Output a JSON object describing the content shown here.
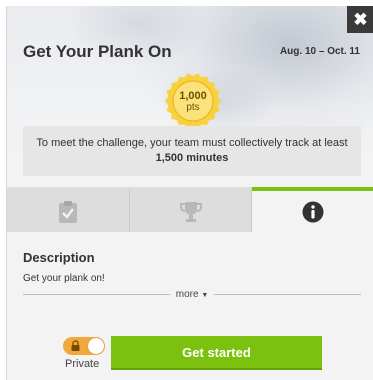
{
  "challenge": {
    "title": "Get Your Plank On",
    "dates": "Aug. 10 – Oct. 11",
    "close_label": "✖"
  },
  "badge": {
    "points": "1,000",
    "points_label": "pts",
    "color": "#f7d23e"
  },
  "goal": {
    "text": "To meet the challenge, your team must collectively track at least",
    "target": "1,500 minutes"
  },
  "tabs": [
    {
      "icon": "clipboard-check-icon",
      "active": false
    },
    {
      "icon": "trophy-icon",
      "active": false
    },
    {
      "icon": "info-icon",
      "active": true
    }
  ],
  "description": {
    "heading": "Description",
    "text": "Get your plank on!",
    "more_label": "more"
  },
  "privacy": {
    "label": "Private",
    "toggle_on": true,
    "toggle_color": "#f2a93b"
  },
  "actions": {
    "start_label": "Get started",
    "accent": "#7cc110"
  }
}
